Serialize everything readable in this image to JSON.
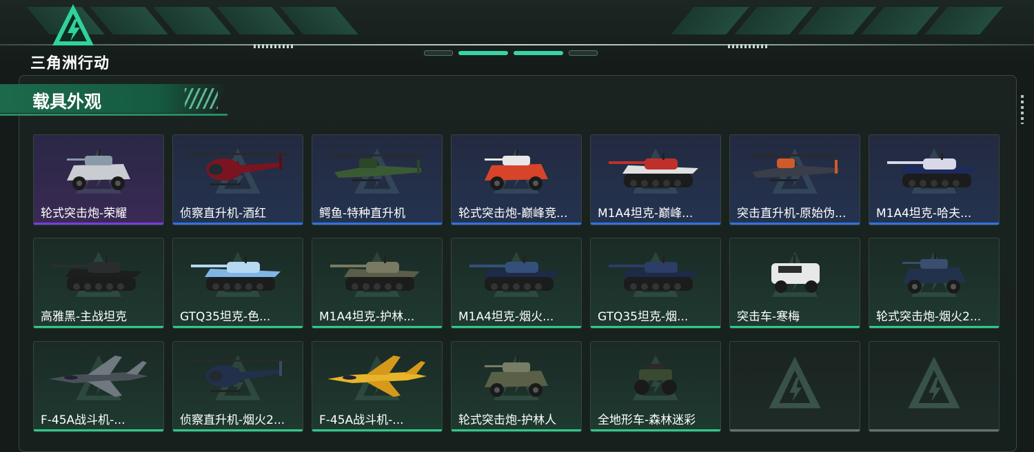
{
  "app": {
    "logo_text": "三角洲行动",
    "logo_icon": "delta-triangle-icon",
    "accent_color": "#35d6a6"
  },
  "section": {
    "title": "载具外观"
  },
  "rarity_colors": {
    "purple": "#7a3ce0",
    "blue": "#2f74e0",
    "green": "#2ec98a",
    "empty": "#6b716f"
  },
  "items": [
    {
      "label": "轮式突击炮-荣耀",
      "rarity": "purple",
      "icon": "wheeled-assault-vehicle-icon"
    },
    {
      "label": "侦察直升机-酒红",
      "rarity": "blue",
      "icon": "scout-helicopter-icon"
    },
    {
      "label": "鳄鱼-特种直升机",
      "rarity": "blue",
      "icon": "attack-helicopter-icon"
    },
    {
      "label": "轮式突击炮-巅峰竞...",
      "rarity": "blue",
      "icon": "wheeled-assault-vehicle-icon"
    },
    {
      "label": "M1A4坦克-巅峰...",
      "rarity": "blue",
      "icon": "tank-icon"
    },
    {
      "label": "突击直升机-原始伪...",
      "rarity": "blue",
      "icon": "attack-helicopter-icon"
    },
    {
      "label": "M1A4坦克-哈夫...",
      "rarity": "blue",
      "icon": "tank-icon"
    },
    {
      "label": "高雅黑-主战坦克",
      "rarity": "green",
      "icon": "tank-icon"
    },
    {
      "label": "GTQ35坦克-色...",
      "rarity": "green",
      "icon": "tank-icon"
    },
    {
      "label": "M1A4坦克-护林...",
      "rarity": "green",
      "icon": "tank-icon"
    },
    {
      "label": "M1A4坦克-烟火...",
      "rarity": "green",
      "icon": "tank-icon"
    },
    {
      "label": "GTQ35坦克-烟...",
      "rarity": "green",
      "icon": "tank-icon"
    },
    {
      "label": "突击车-寒梅",
      "rarity": "green",
      "icon": "armored-car-icon"
    },
    {
      "label": "轮式突击炮-烟火2...",
      "rarity": "green",
      "icon": "wheeled-assault-vehicle-icon"
    },
    {
      "label": "F-45A战斗机-...",
      "rarity": "green",
      "icon": "fighter-jet-icon"
    },
    {
      "label": "侦察直升机-烟火2...",
      "rarity": "green",
      "icon": "scout-helicopter-icon"
    },
    {
      "label": "F-45A战斗机-...",
      "rarity": "green",
      "icon": "fighter-jet-icon"
    },
    {
      "label": "轮式突击炮-护林人",
      "rarity": "green",
      "icon": "wheeled-assault-vehicle-icon"
    },
    {
      "label": "全地形车-森林迷彩",
      "rarity": "green",
      "icon": "atv-icon"
    },
    {
      "label": "",
      "rarity": "empty",
      "icon": "delta-watermark-icon"
    },
    {
      "label": "",
      "rarity": "empty",
      "icon": "delta-watermark-icon"
    }
  ]
}
